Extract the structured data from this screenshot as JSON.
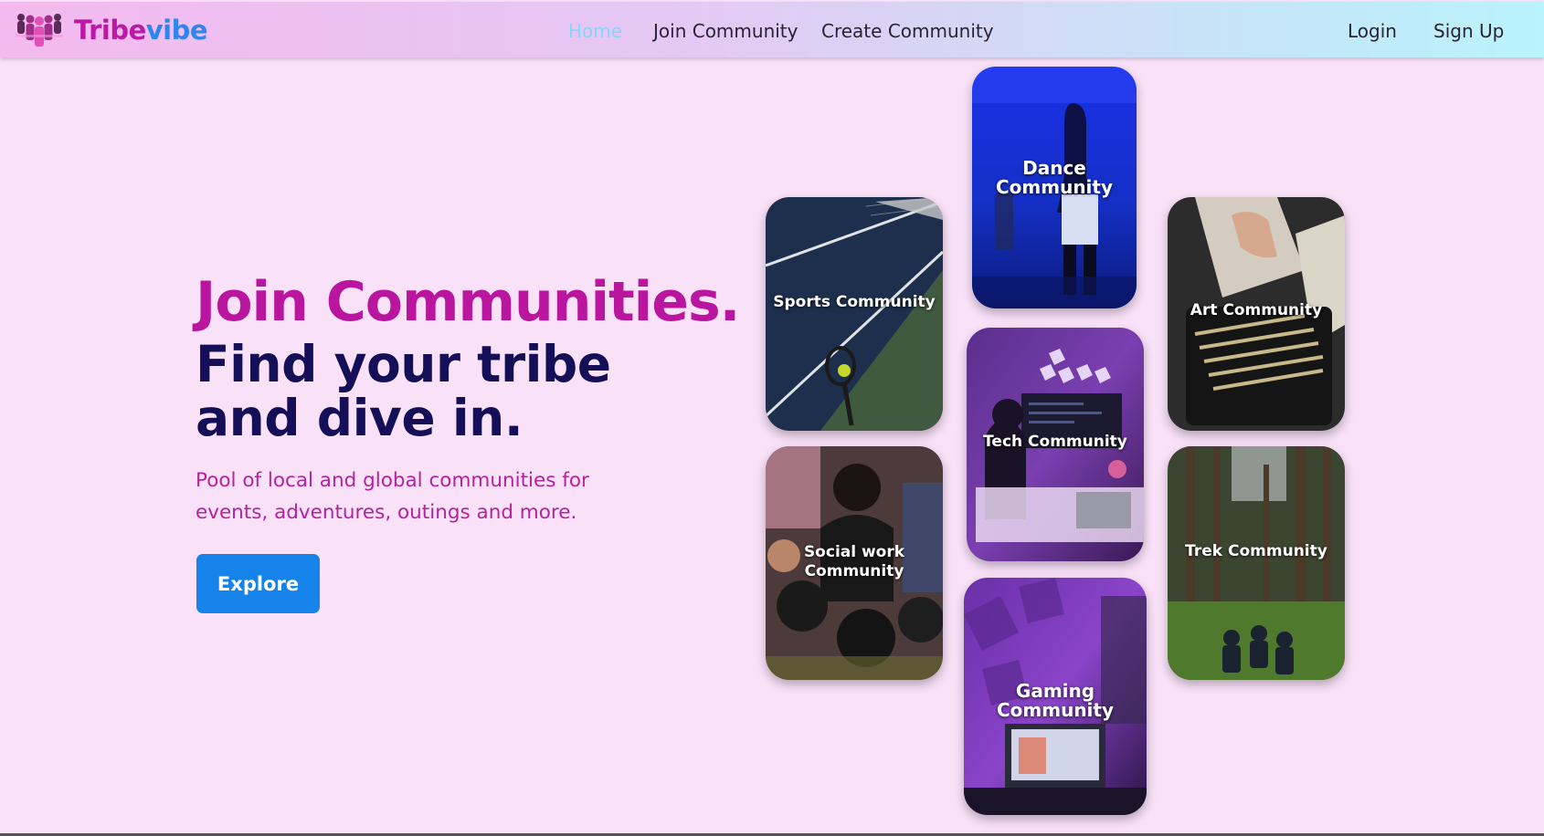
{
  "brand": {
    "part1": "Tribe",
    "part2": "vibe"
  },
  "nav": {
    "links": [
      "Home",
      "Join Community",
      "Create Community"
    ],
    "auth": [
      "Login",
      "Sign Up"
    ]
  },
  "hero": {
    "title": "Join Communities.",
    "subtitle_line1": "Find your tribe",
    "subtitle_line2": "and dive in.",
    "description_line1": "Pool of local and global communities for",
    "description_line2": "events, adventures, outings and more.",
    "cta": "Explore"
  },
  "cards": {
    "dance": "Dance Community",
    "sports": "Sports Community",
    "art": "Art Community",
    "tech": "Tech Community",
    "social_line1": "Social work",
    "social_line2": "Community",
    "trek": "Trek Community",
    "gaming": "Gaming Community"
  },
  "colors": {
    "page_bg": "#f9e1f8",
    "brand_pink": "#bb18a6",
    "brand_blue": "#2d86ef",
    "nav_active": "#86d7f7",
    "heading_dark": "#140f57",
    "button_blue": "#1583ea"
  }
}
